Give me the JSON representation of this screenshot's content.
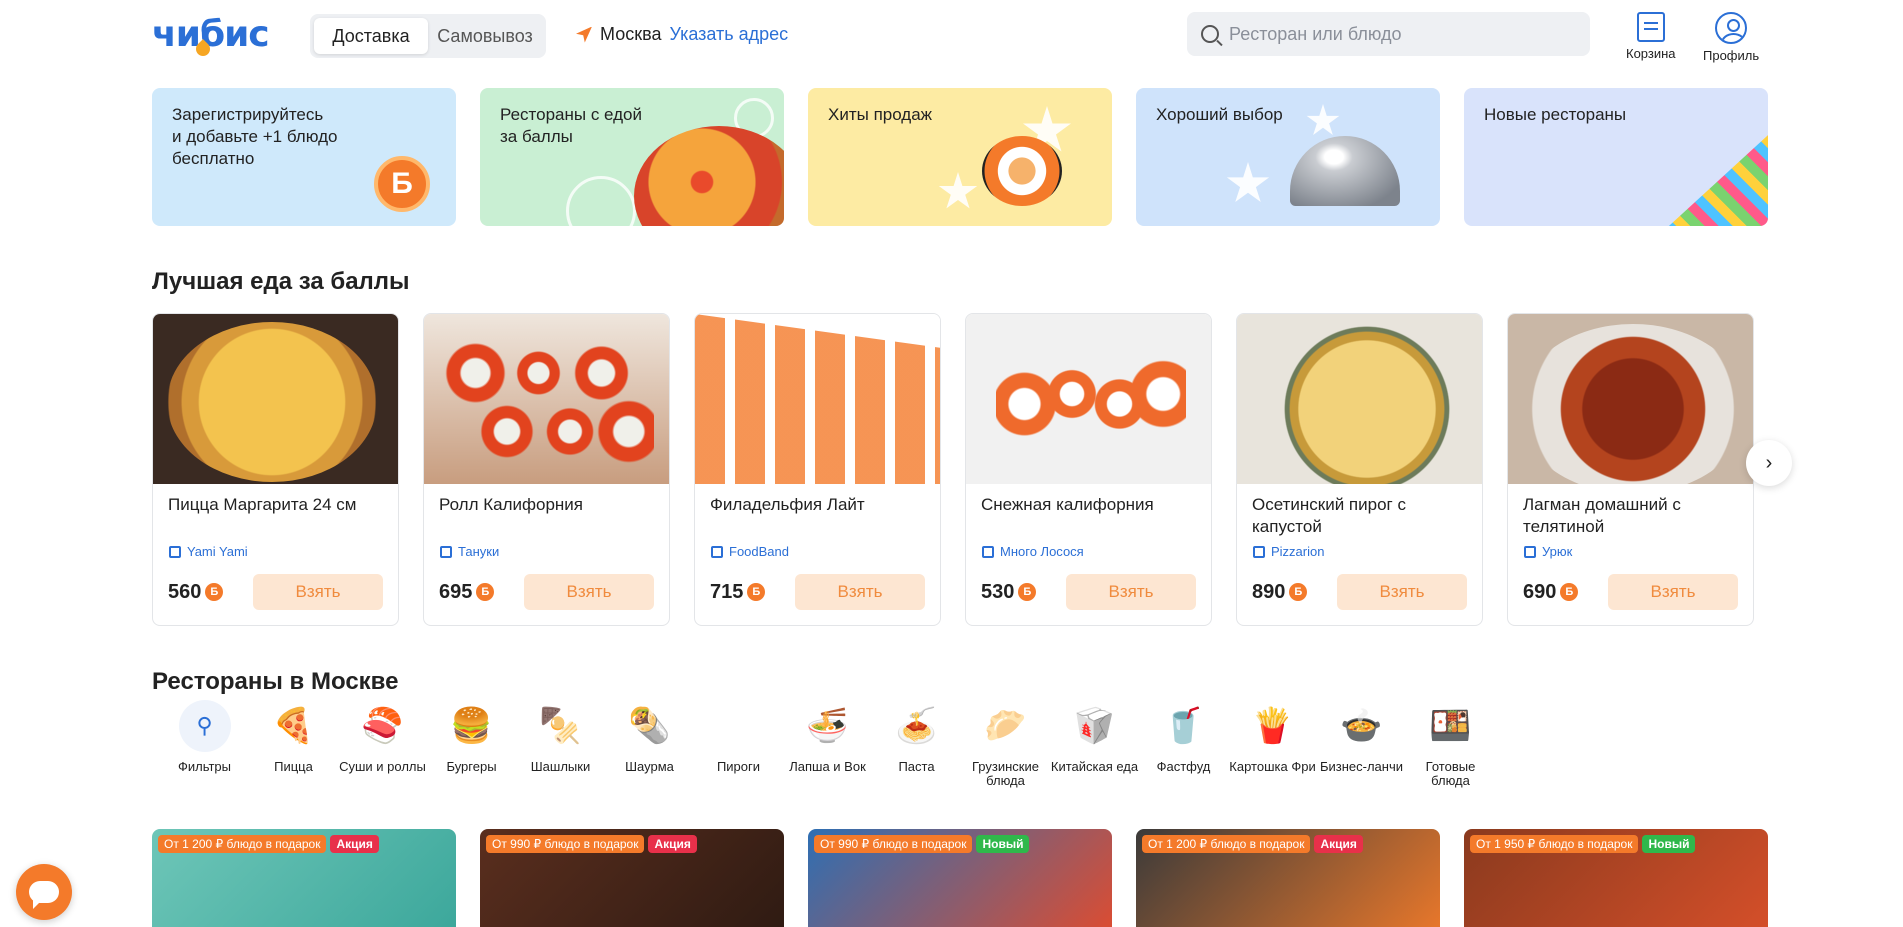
{
  "header": {
    "logo": "чибис",
    "delivery_tabs": [
      {
        "label": "Доставка",
        "active": true
      },
      {
        "label": "Самовывоз",
        "active": false
      }
    ],
    "city": "Москва",
    "address_link": "Указать адрес",
    "search_placeholder": "Ресторан или блюдо",
    "cart_label": "Корзина",
    "profile_label": "Профиль"
  },
  "banners": [
    {
      "text": "Зарегистрируйтесь\nи добавьте +1 блюдо\nбесплатно",
      "color": "#cfe9fb"
    },
    {
      "text": "Рестораны с едой\nза баллы",
      "color": "#c9efd3"
    },
    {
      "text": "Хиты продаж",
      "color": "#fdeba3"
    },
    {
      "text": "Хороший выбор",
      "color": "#cfe3fb"
    },
    {
      "text": "Новые рестораны",
      "color": "#d9e3fb"
    }
  ],
  "points_section": {
    "title": "Лучшая еда за баллы",
    "take_label": "Взять",
    "coin_symbol": "Б",
    "items": [
      {
        "name": "Пицца Маргарита 24 см",
        "restaurant": "Yami Yami",
        "price": "560"
      },
      {
        "name": "Ролл Калифорния",
        "restaurant": "Тануки",
        "price": "695"
      },
      {
        "name": "Филадельфия Лайт",
        "restaurant": "FoodBand",
        "price": "715"
      },
      {
        "name": "Снежная калифорния",
        "restaurant": "Много Лосося",
        "price": "530"
      },
      {
        "name": "Осетинский пирог с капустой",
        "restaurant": "Pizzarion",
        "price": "890"
      },
      {
        "name": "Лагман домашний с телятиной",
        "restaurant": "Урюк",
        "price": "690"
      }
    ]
  },
  "restaurants_section": {
    "title": "Рестораны в Москве",
    "categories": [
      {
        "label": "Фильтры",
        "icon": "filter-icon"
      },
      {
        "label": "Пицца",
        "icon": "pizza-icon"
      },
      {
        "label": "Суши и роллы",
        "icon": "sushi-icon"
      },
      {
        "label": "Бургеры",
        "icon": "burger-icon"
      },
      {
        "label": "Шашлыки",
        "icon": "skewer-icon"
      },
      {
        "label": "Шаурма",
        "icon": "shawarma-icon"
      },
      {
        "label": "Пироги",
        "icon": "pie-icon"
      },
      {
        "label": "Лапша и Вок",
        "icon": "noodles-icon"
      },
      {
        "label": "Паста",
        "icon": "pasta-icon"
      },
      {
        "label": "Грузинские блюда",
        "icon": "khachapuri-icon"
      },
      {
        "label": "Китайская еда",
        "icon": "wok-box-icon"
      },
      {
        "label": "Фастфуд",
        "icon": "fastfood-icon"
      },
      {
        "label": "Картошка Фри",
        "icon": "fries-icon"
      },
      {
        "label": "Бизнес-ланчи",
        "icon": "soup-icon"
      },
      {
        "label": "Готовые блюда",
        "icon": "ready-meal-icon"
      }
    ],
    "cards": [
      {
        "offer": "От 1 200 ₽ блюдо в подарок",
        "badge": "Акция",
        "badge_type": "promo"
      },
      {
        "offer": "От 990 ₽ блюдо в подарок",
        "badge": "Акция",
        "badge_type": "promo"
      },
      {
        "offer": "От 990 ₽ блюдо в подарок",
        "badge": "Новый",
        "badge_type": "new"
      },
      {
        "offer": "От 1 200 ₽ блюдо в подарок",
        "badge": "Акция",
        "badge_type": "promo"
      },
      {
        "offer": "От 1 950 ₽ блюдо в подарок",
        "badge": "Новый",
        "badge_type": "new"
      }
    ]
  },
  "colors": {
    "brand_blue": "#2b6fd6",
    "accent_orange": "#f47a2a",
    "promo_red": "#e8304a",
    "new_green": "#2fb84b"
  }
}
